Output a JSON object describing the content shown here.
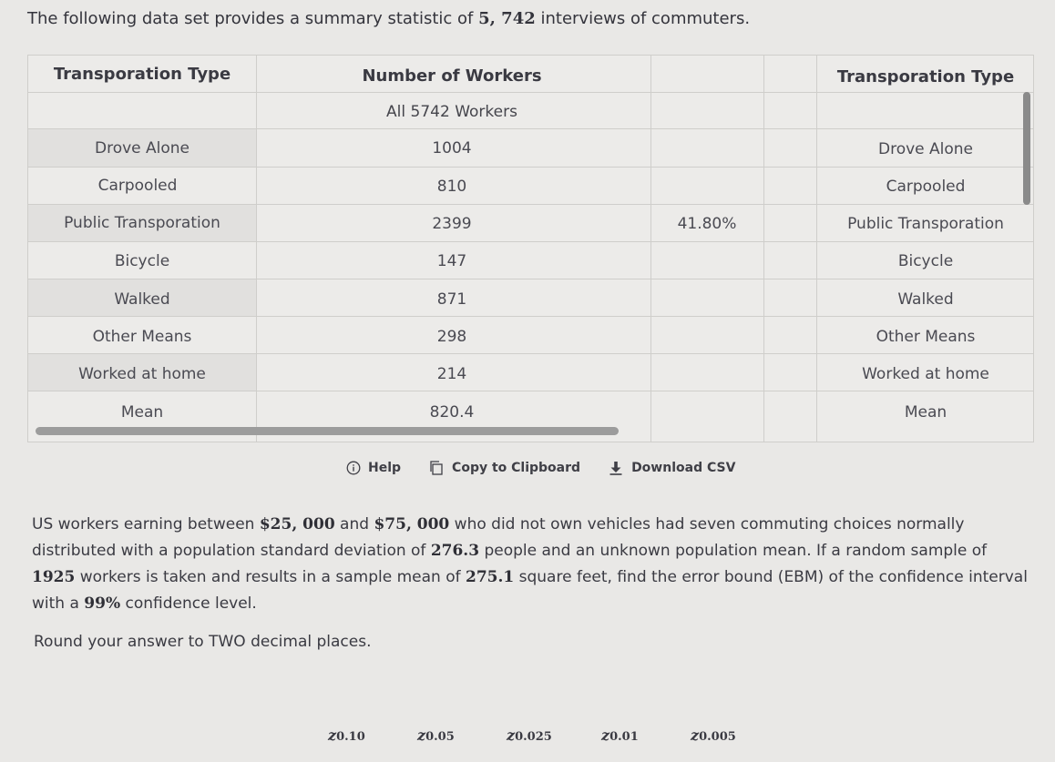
{
  "intro": {
    "pre": "The following data set provides a summary statistic of ",
    "count": "5, 742",
    "post": " interviews of commuters."
  },
  "table": {
    "left_header": "Transporation Type",
    "right_header": "Transporation Type",
    "workers_header": "Number of Workers",
    "workers_sub": "All 5742 Workers",
    "rows": [
      {
        "label": "Drove Alone",
        "value": "1004"
      },
      {
        "label": "Carpooled",
        "value": "810"
      },
      {
        "label": "Public Transporation",
        "value": "2399",
        "extra": "41.80%"
      },
      {
        "label": "Bicycle",
        "value": "147"
      },
      {
        "label": "Walked",
        "value": "871"
      },
      {
        "label": "Other Means",
        "value": "298"
      },
      {
        "label": "Worked at home",
        "value": "214"
      },
      {
        "label": "Mean",
        "value": "820.4"
      }
    ]
  },
  "toolbar": {
    "help": "Help",
    "copy": "Copy to Clipboard",
    "download": "Download CSV"
  },
  "question": {
    "t1": "US workers earning between ",
    "v1": "$25, 000",
    "t2": " and ",
    "v2": "$75, 000",
    "t3": " who did not own vehicles had seven commuting choices normally distributed with a population standard deviation of ",
    "v3": "276.3",
    "t4": " people and an unknown population mean. If a random sample of ",
    "v4": "1925",
    "t5": " workers is taken and results in a sample mean of ",
    "v5": "275.1",
    "t6": " square feet, find the error bound (EBM) of the confidence interval with a ",
    "v6": "99%",
    "t7": " confidence level.",
    "round": "Round your answer to TWO decimal places."
  },
  "z_values": [
    {
      "z": "z",
      "sub": "0.10"
    },
    {
      "z": "z",
      "sub": "0.05"
    },
    {
      "z": "z",
      "sub": "0.025"
    },
    {
      "z": "z",
      "sub": "0.01"
    },
    {
      "z": "z",
      "sub": "0.005"
    }
  ]
}
